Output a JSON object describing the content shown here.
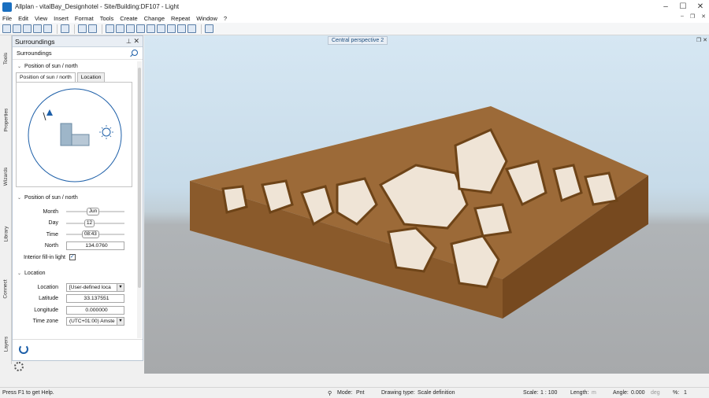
{
  "window": {
    "title": "Allplan - vitalBay_Designhotel - Site/Building:DF107 - Light"
  },
  "menu": {
    "items": [
      "File",
      "Edit",
      "View",
      "Insert",
      "Format",
      "Tools",
      "Create",
      "Change",
      "Repeat",
      "Window",
      "?"
    ]
  },
  "sidetabs": [
    "Tools",
    "Properties",
    "Wizards",
    "Library",
    "Connect",
    "Layers"
  ],
  "panel": {
    "title": "Surroundings",
    "subtitle": "Surroundings",
    "section_sun_north_1": "Position of sun / north",
    "tabs": [
      "Position of sun / north",
      "Location"
    ],
    "section_sun_north_2": "Position of sun / north",
    "month_label": "Month",
    "month_value": "Jun",
    "month_level": 0.41,
    "day_label": "Day",
    "day_value": "12",
    "day_level": 0.37,
    "time_label": "Time",
    "time_value": "08:43",
    "time_level": 0.36,
    "north_label": "North",
    "north_value": "134.0760",
    "interior_label": "Interior fill-in light",
    "interior_checked": true,
    "section_location": "Location",
    "location_label": "Location",
    "location_value": "[User-defined loca",
    "latitude_label": "Latitude",
    "latitude_value": "33.137551",
    "longitude_label": "Longitude",
    "longitude_value": "0.000000",
    "timezone_label": "Time zone",
    "timezone_value": "(UTC+01:00) Amste"
  },
  "viewport": {
    "title": "Central perspective 2"
  },
  "status": {
    "help": "Press F1 to get Help.",
    "mode_label": "Mode:",
    "mode_value": "Pnt",
    "drawing_type_label": "Drawing type:",
    "drawing_type_value": "Scale definition",
    "scale_label": "Scale:",
    "scale_value": "1 : 100",
    "length_label": "Length:",
    "length_unit": "m",
    "angle_label": "Angle:",
    "angle_value": "0.000",
    "angle_unit": "deg",
    "percent_label": "%:",
    "percent_value": "1"
  },
  "colors": {
    "accent": "#1d5fa8",
    "wood": "#8a5a2b",
    "sky": "#d6e7f3"
  }
}
